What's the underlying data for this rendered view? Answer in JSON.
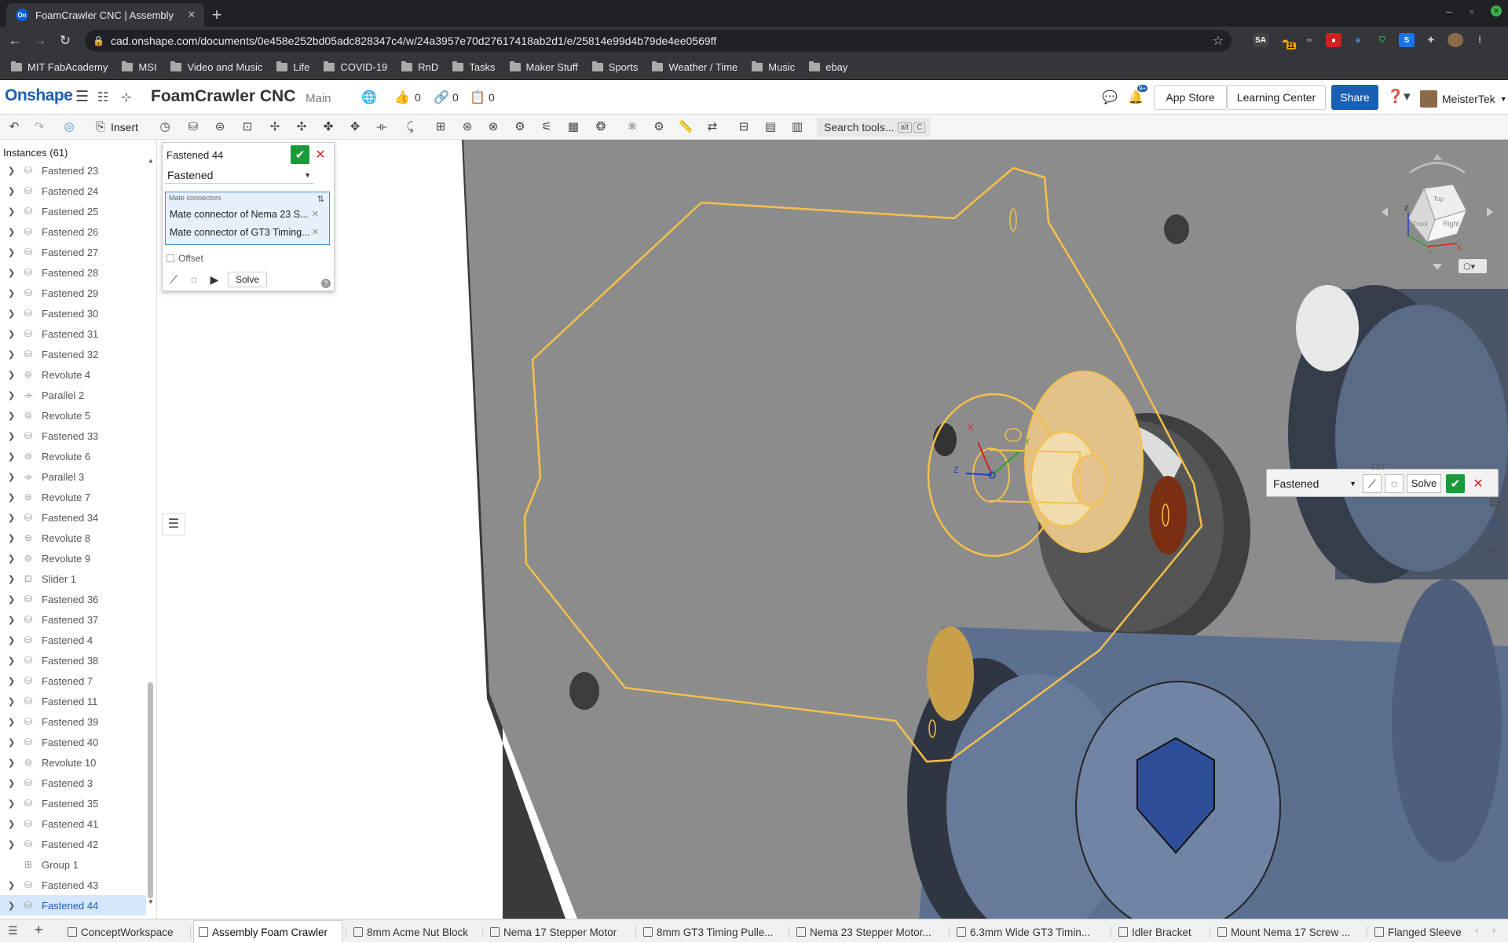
{
  "browser": {
    "tab_title": "FoamCrawler CNC | Assembly",
    "tab_favicon": "On",
    "url": "cad.onshape.com/documents/0e458e252bd05adc828347c4/w/24a3957e70d27617418ab2d1/e/25814e99d4b79de4ee0569ff",
    "ext_badge": "11",
    "bookmarks": [
      "MIT FabAcademy",
      "MSI",
      "Video and Music",
      "Life",
      "COVID-19",
      "RnD",
      "Tasks",
      "Maker Stuff",
      "Sports",
      "Weather / Time",
      "Music",
      "ebay"
    ]
  },
  "header": {
    "logo": "Onshape",
    "doc_title": "FoamCrawler CNC",
    "branch": "Main",
    "likes": "0",
    "links": "0",
    "copies": "0",
    "notif_badge": "9+",
    "app_store": "App Store",
    "learning_center": "Learning Center",
    "share": "Share",
    "user": "MeisterTek"
  },
  "toolbar": {
    "insert": "Insert",
    "search_tools": "Search tools...",
    "shortcut_alt": "alt",
    "shortcut_c": "C"
  },
  "instances": {
    "title": "Instances (61)",
    "items": [
      {
        "label": "Fastened 23",
        "icon": "fastened"
      },
      {
        "label": "Fastened 24",
        "icon": "fastened"
      },
      {
        "label": "Fastened 25",
        "icon": "fastened"
      },
      {
        "label": "Fastened 26",
        "icon": "fastened"
      },
      {
        "label": "Fastened 27",
        "icon": "fastened"
      },
      {
        "label": "Fastened 28",
        "icon": "fastened"
      },
      {
        "label": "Fastened 29",
        "icon": "fastened"
      },
      {
        "label": "Fastened 30",
        "icon": "fastened"
      },
      {
        "label": "Fastened 31",
        "icon": "fastened"
      },
      {
        "label": "Fastened 32",
        "icon": "fastened"
      },
      {
        "label": "Revolute 4",
        "icon": "revolute"
      },
      {
        "label": "Parallel 2",
        "icon": "parallel"
      },
      {
        "label": "Revolute 5",
        "icon": "revolute"
      },
      {
        "label": "Fastened 33",
        "icon": "fastened"
      },
      {
        "label": "Revolute 6",
        "icon": "revolute"
      },
      {
        "label": "Parallel 3",
        "icon": "parallel"
      },
      {
        "label": "Revolute 7",
        "icon": "revolute"
      },
      {
        "label": "Fastened 34",
        "icon": "fastened"
      },
      {
        "label": "Revolute 8",
        "icon": "revolute"
      },
      {
        "label": "Revolute 9",
        "icon": "revolute"
      },
      {
        "label": "Slider 1",
        "icon": "slider"
      },
      {
        "label": "Fastened 36",
        "icon": "fastened"
      },
      {
        "label": "Fastened 37",
        "icon": "fastened"
      },
      {
        "label": "Fastened 4",
        "icon": "fastened"
      },
      {
        "label": "Fastened 38",
        "icon": "fastened"
      },
      {
        "label": "Fastened 7",
        "icon": "fastened"
      },
      {
        "label": "Fastened 11",
        "icon": "fastened"
      },
      {
        "label": "Fastened 39",
        "icon": "fastened"
      },
      {
        "label": "Fastened 40",
        "icon": "fastened"
      },
      {
        "label": "Revolute 10",
        "icon": "revolute"
      },
      {
        "label": "Fastened 3",
        "icon": "fastened"
      },
      {
        "label": "Fastened 35",
        "icon": "fastened"
      },
      {
        "label": "Fastened 41",
        "icon": "fastened"
      },
      {
        "label": "Fastened 42",
        "icon": "fastened"
      },
      {
        "label": "Group 1",
        "icon": "group"
      },
      {
        "label": "Fastened 43",
        "icon": "fastened"
      },
      {
        "label": "Fastened 44",
        "icon": "fastened",
        "selected": true
      }
    ]
  },
  "dialog": {
    "title": "Fastened 44",
    "mate_type": "Fastened",
    "mate_connectors_label": "Mate connectors",
    "connector_1": "Mate connector of Nema 23 S...",
    "connector_2": "Mate connector of GT3 Timing...",
    "offset": "Offset",
    "solve": "Solve"
  },
  "float_toolbar": {
    "mate_type": "Fastened",
    "solve": "Solve"
  },
  "triad": {
    "x": "X",
    "y": "Y",
    "z": "Z"
  },
  "view_cube": {
    "top": "Top",
    "front": "Front",
    "right": "Right",
    "x": "X",
    "y": "Y",
    "z": "Z"
  },
  "bottom_tabs": [
    {
      "label": "ConceptWorkspace",
      "kind": "partstudio"
    },
    {
      "label": "Assembly Foam Crawler",
      "kind": "assembly",
      "active": true
    },
    {
      "label": "8mm Acme Nut Block",
      "kind": "partstudio"
    },
    {
      "label": "Nema 17 Stepper Motor",
      "kind": "partstudio"
    },
    {
      "label": "8mm GT3 Timing Pulle...",
      "kind": "partstudio"
    },
    {
      "label": "Nema 23 Stepper Motor...",
      "kind": "partstudio"
    },
    {
      "label": "6.3mm Wide GT3 Timin...",
      "kind": "partstudio"
    },
    {
      "label": "Idler Bracket",
      "kind": "partstudio"
    },
    {
      "label": "Mount Nema 17 Screw ...",
      "kind": "partstudio"
    },
    {
      "label": "Flanged Sleeve",
      "kind": "partstudio"
    }
  ],
  "colors": {
    "accent": "#1a5fb4",
    "selection": "#f5c04a",
    "ok": "#1a9b3a",
    "cancel": "#e02020"
  }
}
